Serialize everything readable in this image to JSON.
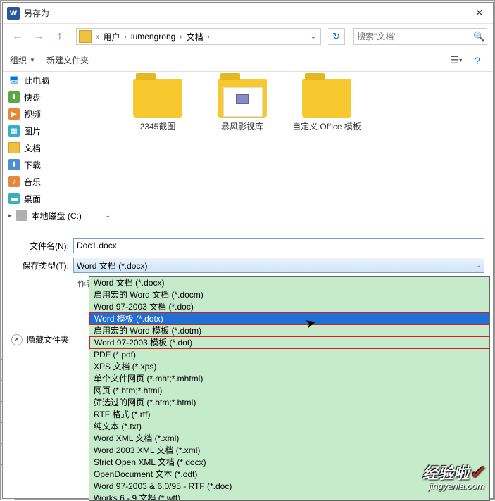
{
  "titlebar": {
    "title": "另存为"
  },
  "breadcrumb": {
    "items": [
      "用户",
      "lumengrong",
      "文档"
    ]
  },
  "search": {
    "placeholder": "搜索\"文档\""
  },
  "toolbar": {
    "organize": "组织",
    "new_folder": "新建文件夹"
  },
  "sidebar": {
    "items": [
      {
        "label": "此电脑"
      },
      {
        "label": "快盘"
      },
      {
        "label": "视频"
      },
      {
        "label": "图片"
      },
      {
        "label": "文档"
      },
      {
        "label": "下载"
      },
      {
        "label": "音乐"
      },
      {
        "label": "桌面"
      },
      {
        "label": "本地磁盘 (C:)"
      }
    ]
  },
  "files": {
    "items": [
      {
        "label": "2345截图"
      },
      {
        "label": "暴风影视库"
      },
      {
        "label": "自定义 Office 模板"
      }
    ]
  },
  "form": {
    "filename_label": "文件名(N):",
    "filename_value": "Doc1.docx",
    "type_label": "保存类型(T):",
    "type_value": "Word 文档 (*.docx)",
    "author_label": "作者:"
  },
  "dropdown": {
    "items": [
      "Word 文档 (*.docx)",
      "启用宏的 Word 文档 (*.docm)",
      "Word 97-2003 文档 (*.doc)",
      "Word 模板 (*.dotx)",
      "启用宏的 Word 模板 (*.dotm)",
      "Word 97-2003 模板 (*.dot)",
      "PDF (*.pdf)",
      "XPS 文档 (*.xps)",
      "单个文件网页 (*.mht;*.mhtml)",
      "网页 (*.htm;*.html)",
      "筛选过的网页 (*.htm;*.html)",
      "RTF 格式 (*.rtf)",
      "纯文本 (*.txt)",
      "Word XML 文档 (*.xml)",
      "Word 2003 XML 文档 (*.xml)",
      "Strict Open XML 文档 (*.docx)",
      "OpenDocument 文本 (*.odt)",
      "Word 97-2003 & 6.0/95 - RTF (*.doc)",
      "Works 6 - 9 文档 (*.wtf)"
    ],
    "selected_index": 3,
    "boxed_indices": [
      3,
      5
    ]
  },
  "hide_folders": {
    "label": "隐藏文件夹"
  },
  "watermark": {
    "main": "经验啦",
    "sub": "jingyanla.com"
  }
}
